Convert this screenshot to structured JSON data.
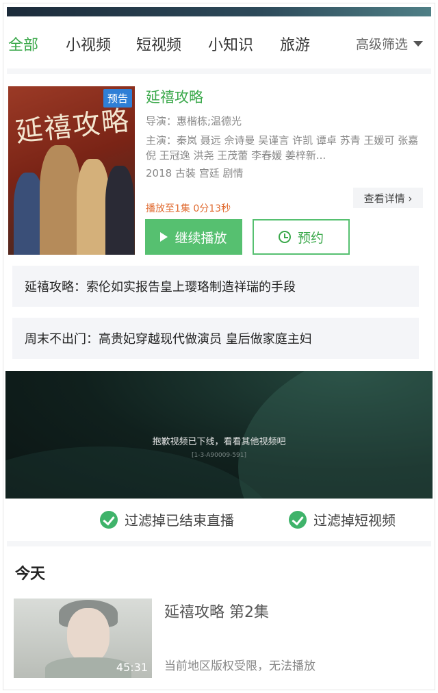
{
  "tabs": [
    {
      "label": "全部",
      "active": true
    },
    {
      "label": "小视频",
      "active": false
    },
    {
      "label": "短视频",
      "active": false
    },
    {
      "label": "小知识",
      "active": false
    },
    {
      "label": "旅游",
      "active": false
    }
  ],
  "filter_label": "高级筛选",
  "show": {
    "badge": "预告",
    "poster_title": "延禧攻略",
    "title": "延禧攻略",
    "director": "导演：惠楷栋;温德光",
    "cast": "主演：秦岚  聂远  佘诗曼  吴谨言  许凯  谭卓  苏青  王媛可  张嘉倪  王冠逸  洪尧  王茂蕾  李春媛  姜梓新...",
    "tags": "2018  古装  宫廷  剧情",
    "detail_label": "查看详情 ›",
    "progress": "播放至1集 0分13秒",
    "play_label": "继续播放",
    "reserve_label": "预约"
  },
  "news": [
    "延禧攻略：索伦如实报告皇上璎珞制造祥瑞的手段",
    "周末不出门：高贵妃穿越现代做演员 皇后做家庭主妇"
  ],
  "video": {
    "message": "抱歉视频已下线，看看其他视频吧",
    "code": "[1-3-A90009-591]"
  },
  "filters": [
    {
      "label": "过滤掉已结束直播",
      "checked": true
    },
    {
      "label": "过滤掉短视频",
      "checked": true
    }
  ],
  "section_title": "今天",
  "recent": {
    "title": "延禧攻略 第2集",
    "duration": "45:31",
    "note": "当前地区版权受限，无法播放"
  },
  "colors": {
    "accent": "#3aa84a",
    "button_green": "#56c070",
    "badge_blue": "#2f7fd6",
    "progress_orange": "#e06a2f"
  },
  "icons": [
    "caret-down-icon",
    "play-icon",
    "clock-icon",
    "check-circle-icon"
  ]
}
